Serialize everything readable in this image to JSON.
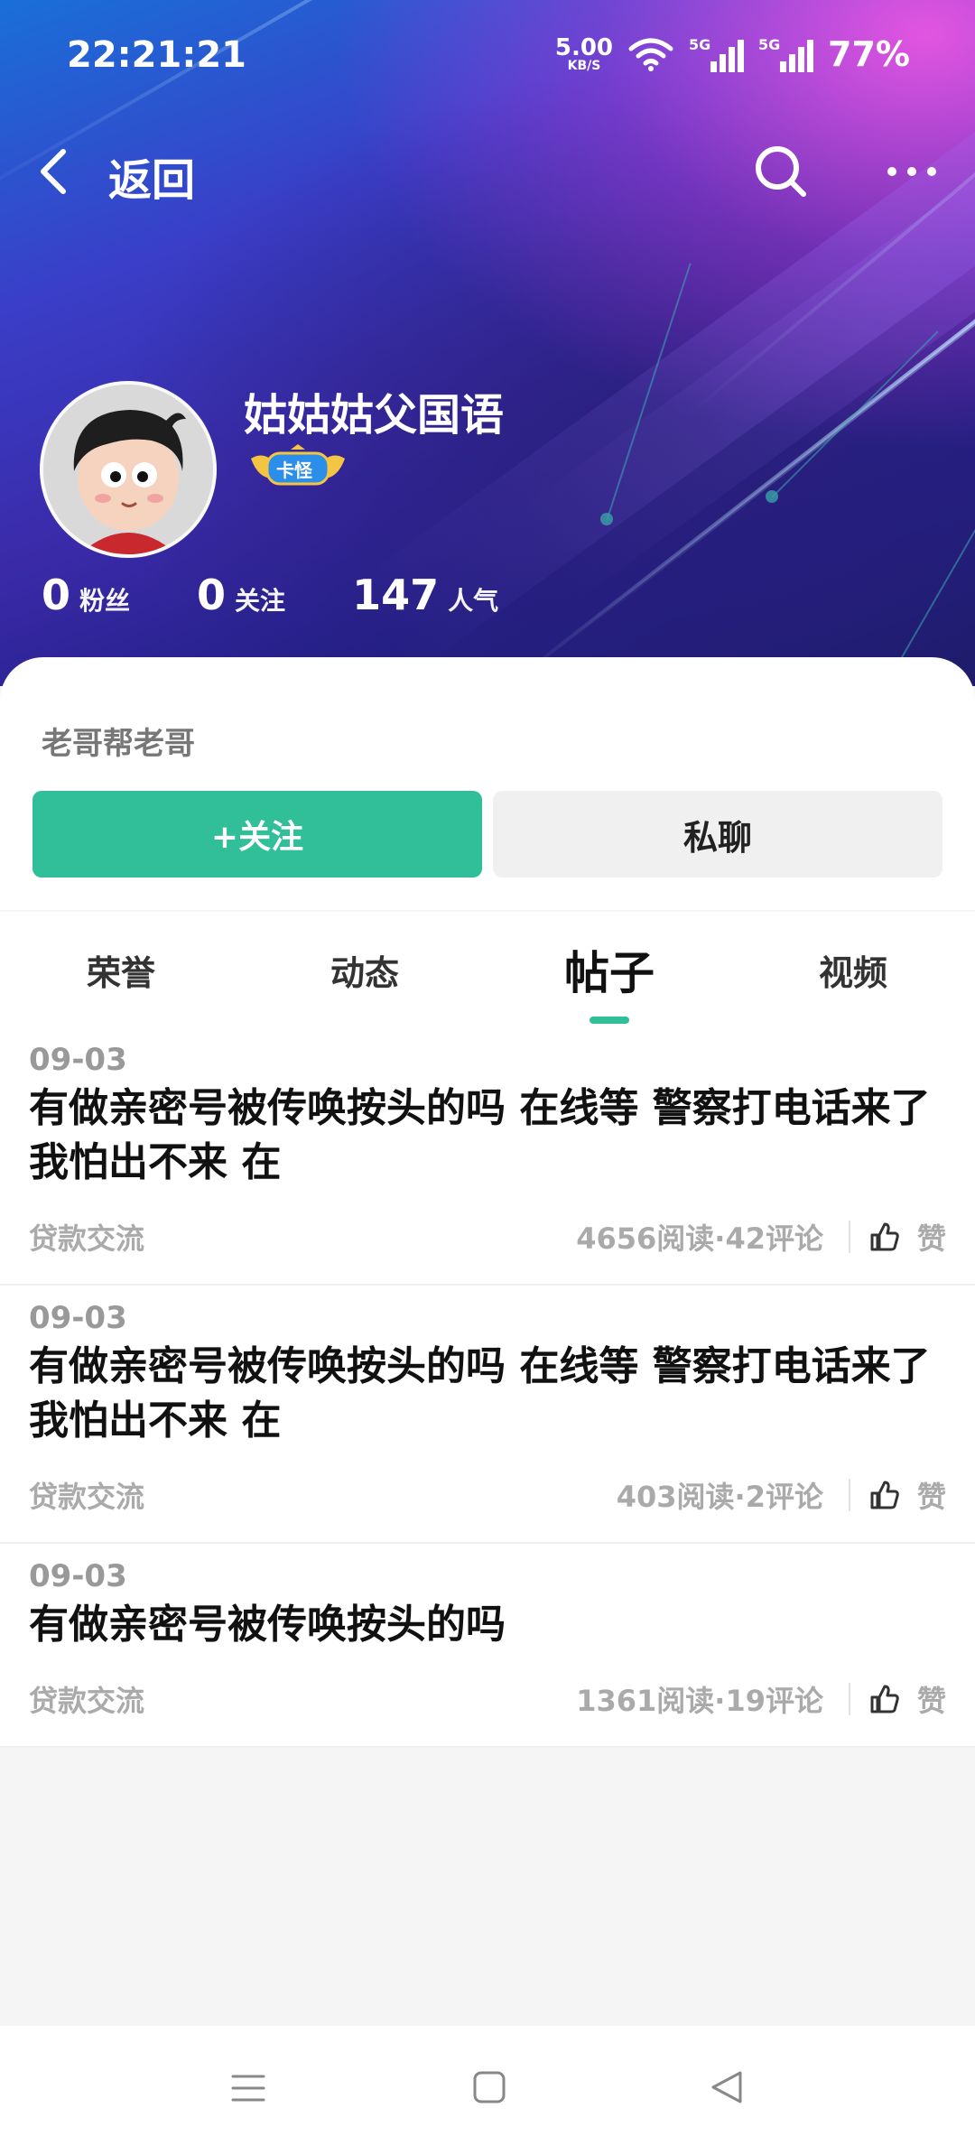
{
  "status_bar": {
    "time": "22:21:21",
    "net_speed_value": "5.00",
    "net_speed_unit": "KB/S",
    "signal1_label": "5G",
    "signal2_label": "5G",
    "battery": "77%"
  },
  "nav": {
    "back_label": "返回"
  },
  "profile": {
    "username": "姑姑姑父国语",
    "badge": "卡怪",
    "stats": [
      {
        "value": "0",
        "label": "粉丝"
      },
      {
        "value": "0",
        "label": "关注"
      },
      {
        "value": "147",
        "label": "人气"
      }
    ],
    "bio": "老哥帮老哥"
  },
  "actions": {
    "follow_label": "+关注",
    "chat_label": "私聊"
  },
  "tabs": [
    {
      "label": "荣誉",
      "active": false
    },
    {
      "label": "动态",
      "active": false
    },
    {
      "label": "帖子",
      "active": true
    },
    {
      "label": "视频",
      "active": false
    }
  ],
  "posts": [
    {
      "date": "09-03",
      "title": "有做亲密号被传唤按头的吗 在线等 警察打电话来了 我怕出不来 在",
      "category": "贷款交流",
      "stats": "4656阅读·42评论",
      "like_label": "赞"
    },
    {
      "date": "09-03",
      "title": "有做亲密号被传唤按头的吗 在线等 警察打电话来了 我怕出不来 在",
      "category": "贷款交流",
      "stats": "403阅读·2评论",
      "like_label": "赞"
    },
    {
      "date": "09-03",
      "title": "有做亲密号被传唤按头的吗",
      "category": "贷款交流",
      "stats": "1361阅读·19评论",
      "like_label": "赞"
    }
  ],
  "colors": {
    "accent": "#31bf9a",
    "chat_bg": "#f0f0f0"
  }
}
